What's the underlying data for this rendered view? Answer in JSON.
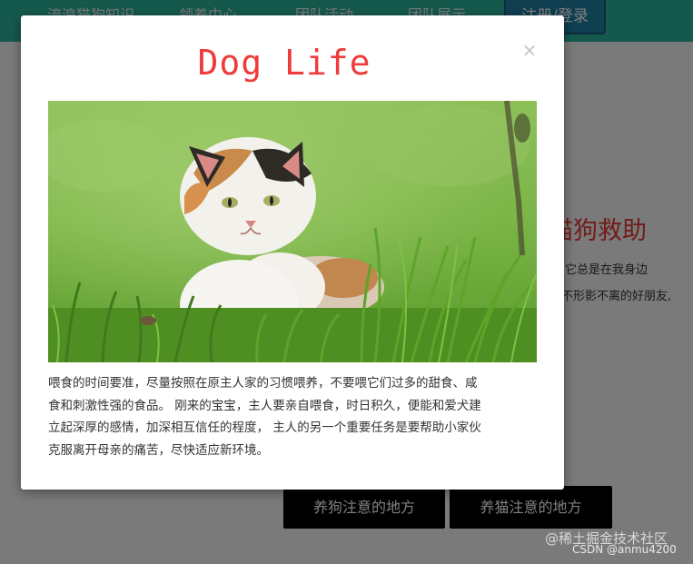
{
  "nav": {
    "items": [
      "流浪猫狗知识",
      "领养中心",
      "团队活动",
      "团队展示"
    ],
    "login_label": "注册/登录"
  },
  "background": {
    "heading": "猫狗救助",
    "paragraph_lines": [
      "时，它总是在我身边",
      "不形影不离的好朋友,"
    ],
    "buttons": [
      "养狗注意的地方",
      "养猫注意的地方"
    ]
  },
  "modal": {
    "title": "Dog Life",
    "close_glyph": "×",
    "text_lines": [
      "喂食的时间要准，尽量按照在原主人家的习惯喂养，不要喂它们过多的甜食、咸",
      "食和刺激性强的食品。 刚来的宝宝，主人要亲自喂食，时日积久，便能和爱犬建",
      "立起深厚的感情，加深相互信任的程度， 主人的另一个重要任务是要帮助小家伙",
      "克服离开母亲的痛苦，尽快适应新环境。"
    ]
  },
  "watermark": {
    "line1": "@稀土掘金技术社区",
    "line2": "CSDN @anmu4200"
  },
  "colors": {
    "nav_bg": "#2ab39a",
    "title_red": "#ee3b3b",
    "overlay": "rgba(0,0,0,0.5)"
  }
}
